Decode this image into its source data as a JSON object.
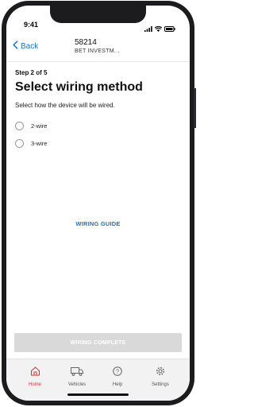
{
  "status": {
    "time": "9:41"
  },
  "nav": {
    "back_label": "Back",
    "title": "58214",
    "subtitle": "BET INVESTM..."
  },
  "step_label": "Step 2 of 5",
  "heading": "Select wiring method",
  "instruction": "Select how the device will be wired.",
  "options": [
    {
      "label": "2-wire"
    },
    {
      "label": "3-wire"
    }
  ],
  "wiring_guide_label": "WIRING GUIDE",
  "complete_button": {
    "label": "WIRING COMPLETE",
    "enabled": false
  },
  "tabs": [
    {
      "label": "Home",
      "icon": "home-icon",
      "active": true
    },
    {
      "label": "Vehicles",
      "icon": "truck-icon",
      "active": false
    },
    {
      "label": "Help",
      "icon": "help-icon",
      "active": false
    },
    {
      "label": "Settings",
      "icon": "gear-icon",
      "active": false
    }
  ],
  "colors": {
    "accent": "#1a73c8",
    "active_tab": "#d9342b",
    "disabled_button": "#d9d9d9"
  }
}
